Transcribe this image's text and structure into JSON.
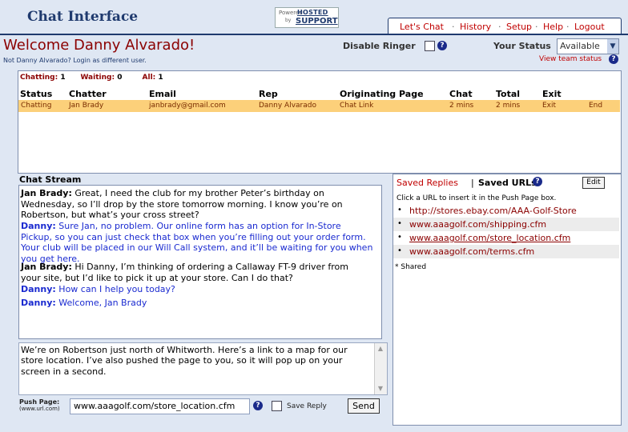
{
  "header": {
    "title": "Chat Interface",
    "powered": {
      "line1": "Powered",
      "line2": "by",
      "brand1": "HOSTED",
      "brand2": "SUPPORT"
    },
    "nav": [
      "Let's Chat",
      "History",
      "Setup",
      "Help",
      "Logout"
    ],
    "nav_sep": "·"
  },
  "welcome": {
    "greeting": "Welcome Danny Alvarado!",
    "not_user": "Not Danny Alvarado?  Login as different user.",
    "disable_ringer_label": "Disable Ringer",
    "help_glyph": "?",
    "your_status_label": "Your Status",
    "status_value": "Available",
    "view_team_status": "View team status"
  },
  "queue": {
    "counts": [
      {
        "label": "Chatting:",
        "value": "1"
      },
      {
        "label": "Waiting:",
        "value": "0"
      },
      {
        "label": "All:",
        "value": "1"
      }
    ],
    "columns": [
      "Status",
      "Chatter",
      "Email",
      "Rep",
      "Originating Page",
      "Chat",
      "Total",
      "Exit"
    ],
    "rows": [
      {
        "status": "Chatting",
        "chatter": "Jan Brady",
        "email": "janbrady@gmail.com",
        "rep": "Danny Alvarado",
        "page": "Chat Link",
        "chat": "2 mins",
        "total": "2 mins",
        "exit": "Exit",
        "end": "End"
      }
    ]
  },
  "stream": {
    "title": "Chat Stream",
    "messages": [
      {
        "speaker": "Jan Brady:",
        "lines": [
          "Great, I need the club for my brother Peter’s birthday on",
          "Wednesday, so I’ll drop by the store tomorrow morning. I know you’re on",
          "Robertson, but what’s your cross street?"
        ],
        "role": "chatter"
      },
      {
        "speaker": "Danny:",
        "lines": [
          "Sure Jan, no problem. Our online form has an option for In-Store",
          "Pickup, so you can just check that box when you’re filling out your order form.",
          "Your club will be placed in our Will Call system, and it’ll be waiting for you when",
          "you get here."
        ],
        "role": "rep"
      },
      {
        "speaker": "Jan Brady:",
        "lines": [
          "Hi Danny, I’m thinking of ordering a Callaway FT-9 driver from",
          "your site, but I’d like to pick it up at your store. Can I do that?"
        ],
        "role": "chatter"
      },
      {
        "speaker": "Danny:",
        "lines": [
          "How can I help you today?"
        ],
        "role": "rep"
      },
      {
        "speaker": "Danny:",
        "lines": [
          "Welcome, Jan Brady"
        ],
        "role": "rep"
      }
    ],
    "reply_lines": [
      "We’re on Robertson just north of Whitworth.  Here’s a link to a map for our",
      "store location.  I’ve also pushed the page to you, so it will pop up on your",
      "screen in a second."
    ],
    "push_label": "Push Page:",
    "push_hint": "(www.url.com)",
    "push_value": "www.aaagolf.com/store_location.cfm",
    "save_reply_label": "Save Reply",
    "send_label": "Send"
  },
  "saved": {
    "replies_label": "Saved Replies",
    "separator": "|",
    "urls_label": "Saved URLs",
    "edit_label": "Edit",
    "help_text": "Click a URL to insert it in the Push Page box.",
    "urls": [
      "http://stores.ebay.com/AAA-Golf-Store",
      "www.aaagolf.com/shipping.cfm",
      "www.aaagolf.com/store_location.cfm",
      "www.aaagolf.com/terms.cfm"
    ],
    "shared_note": "* Shared"
  },
  "colors": {
    "accent": "#1f3a6e",
    "link_red": "#c00000",
    "row_highlight": "#fcd07a",
    "rep_blue": "#1a2ad0"
  }
}
